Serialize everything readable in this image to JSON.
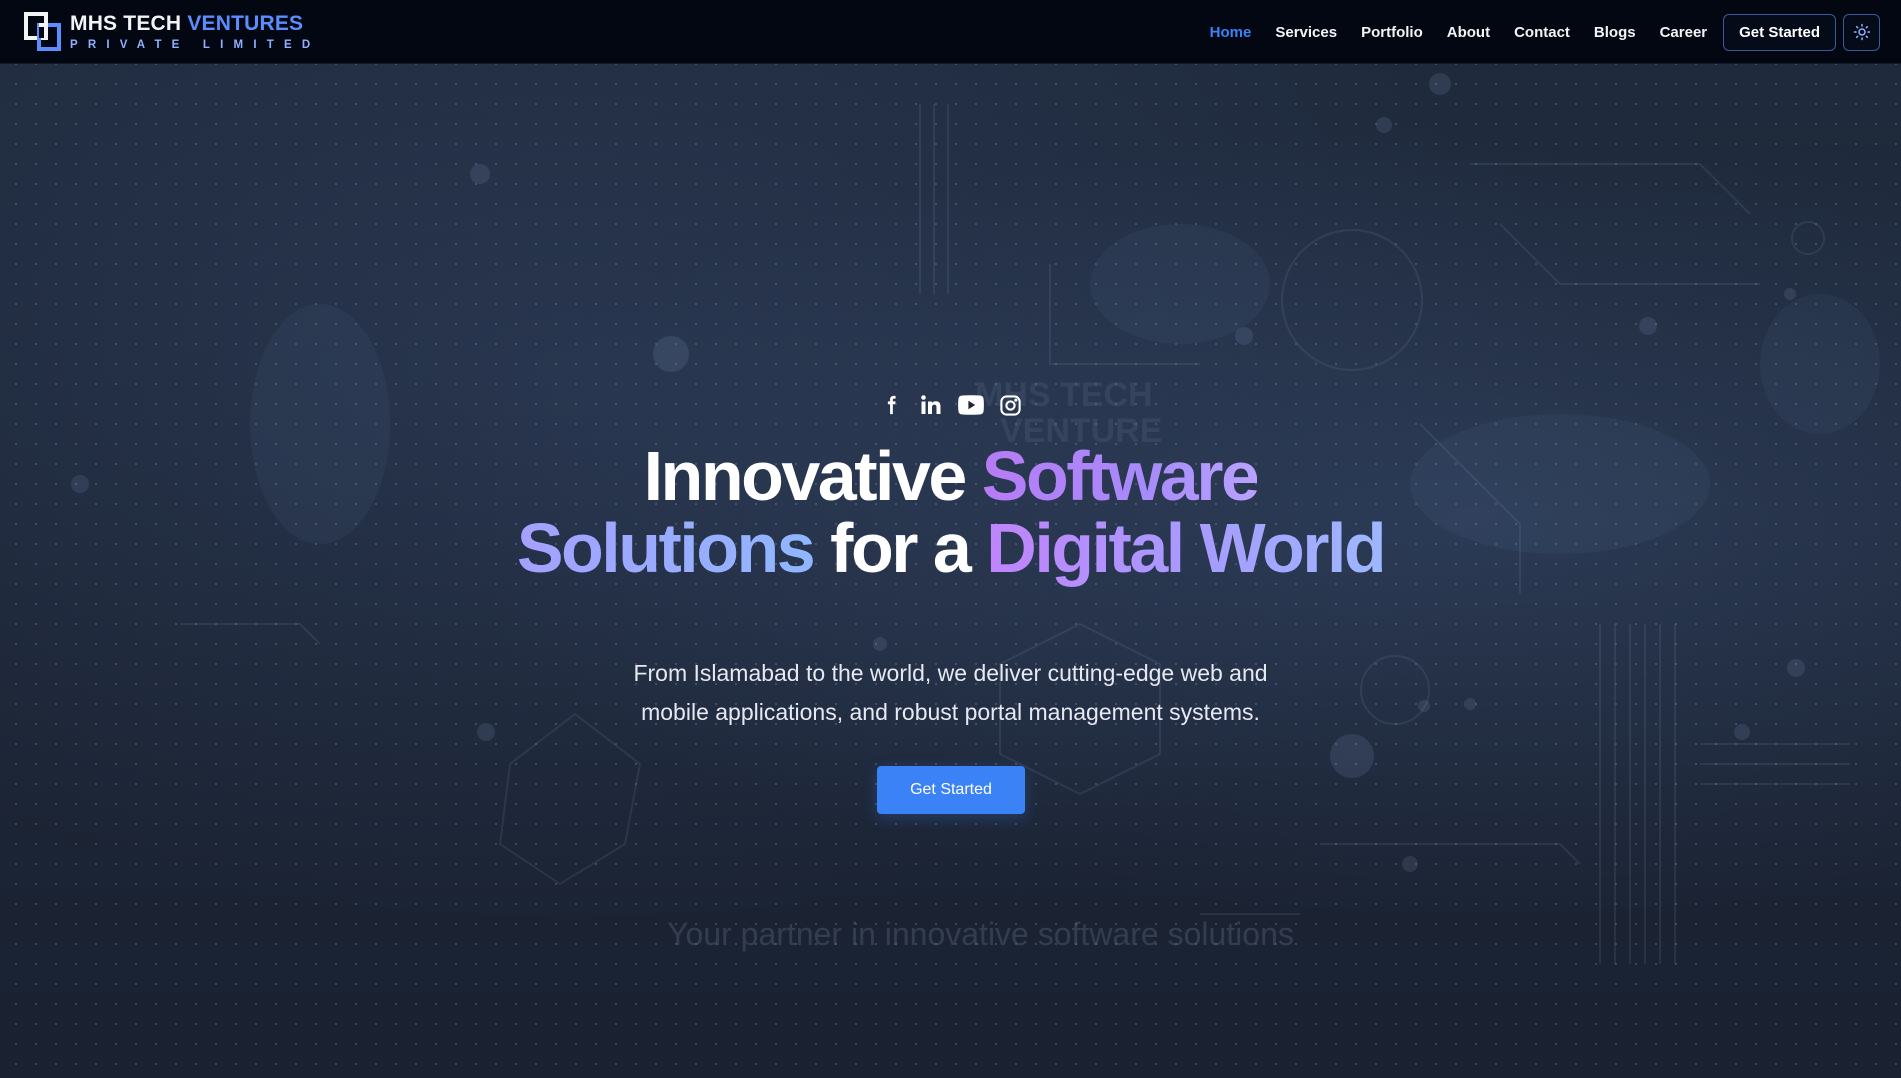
{
  "header": {
    "logo": {
      "name_part1": "MHS TECH",
      "name_part2": "VENTURES",
      "tagline": "PRIVATE LIMITED"
    },
    "nav": [
      {
        "label": "Home",
        "active": true
      },
      {
        "label": "Services",
        "active": false
      },
      {
        "label": "Portfolio",
        "active": false
      },
      {
        "label": "About",
        "active": false
      },
      {
        "label": "Contact",
        "active": false
      },
      {
        "label": "Blogs",
        "active": false
      },
      {
        "label": "Career",
        "active": false
      }
    ],
    "cta_label": "Get Started",
    "theme_toggle_icon": "sun-icon"
  },
  "hero": {
    "social_icons": [
      "facebook-icon",
      "linkedin-icon",
      "youtube-icon",
      "instagram-icon"
    ],
    "headline": {
      "part1": "Innovative ",
      "part2": "Software",
      "part3": "Solutions",
      "part4": " for a ",
      "part5": "Digital World"
    },
    "subtext_line1": "From Islamabad to the world, we deliver cutting-edge web and",
    "subtext_line2": "mobile applications, and robust portal management systems.",
    "cta_label": "Get Started",
    "background_watermark": "Your partner in innovative software solutions"
  },
  "colors": {
    "accent": "#3b82f6",
    "header_bg": "#030712",
    "hero_bg": "#1d2636",
    "gradient_purple": "#c084fc",
    "gradient_blue": "#93b4ff"
  }
}
